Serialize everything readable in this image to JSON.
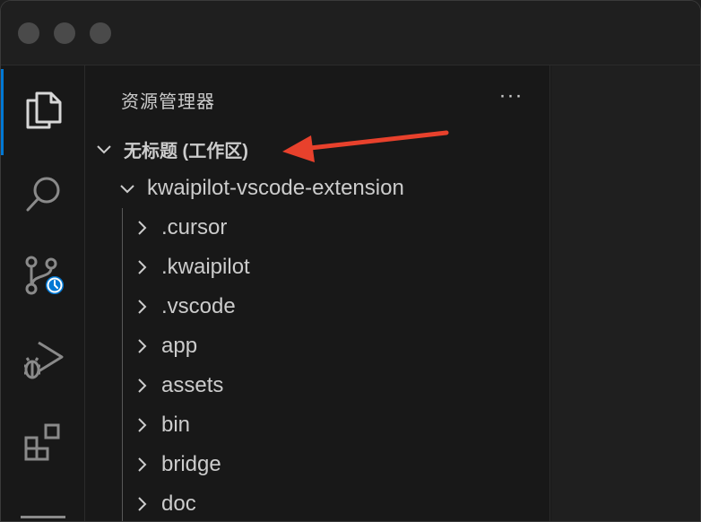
{
  "sidebar": {
    "title": "资源管理器",
    "more_label": "···",
    "workspace_label": "无标题 (工作区)",
    "root_folder": "kwaipilot-vscode-extension",
    "items": [
      {
        "label": ".cursor"
      },
      {
        "label": ".kwaipilot"
      },
      {
        "label": ".vscode"
      },
      {
        "label": "app"
      },
      {
        "label": "assets"
      },
      {
        "label": "bin"
      },
      {
        "label": "bridge"
      },
      {
        "label": "doc"
      }
    ]
  },
  "activity_bar": {
    "items": [
      "explorer-icon",
      "search-icon",
      "source-control-icon",
      "run-debug-icon",
      "extensions-icon"
    ],
    "active": "explorer-icon"
  },
  "colors": {
    "accent": "#0078d4",
    "annotation_arrow": "#e8412c",
    "text": "#cccccc",
    "background": "#181818"
  }
}
